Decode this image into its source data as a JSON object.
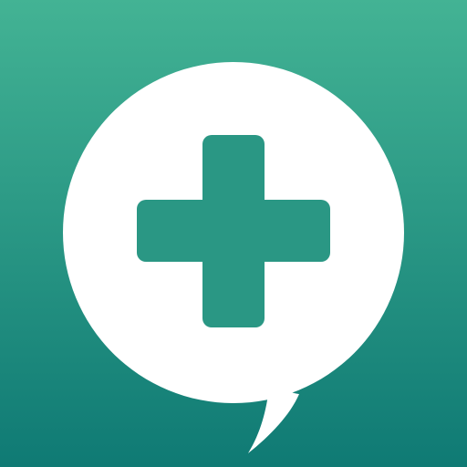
{
  "icon": {
    "name": "medical-chat-app-icon",
    "background_gradient": {
      "top": "#43b394",
      "bottom": "#0f7a74"
    },
    "bubble_color": "#ffffff",
    "cross_color": "#2a9784"
  }
}
